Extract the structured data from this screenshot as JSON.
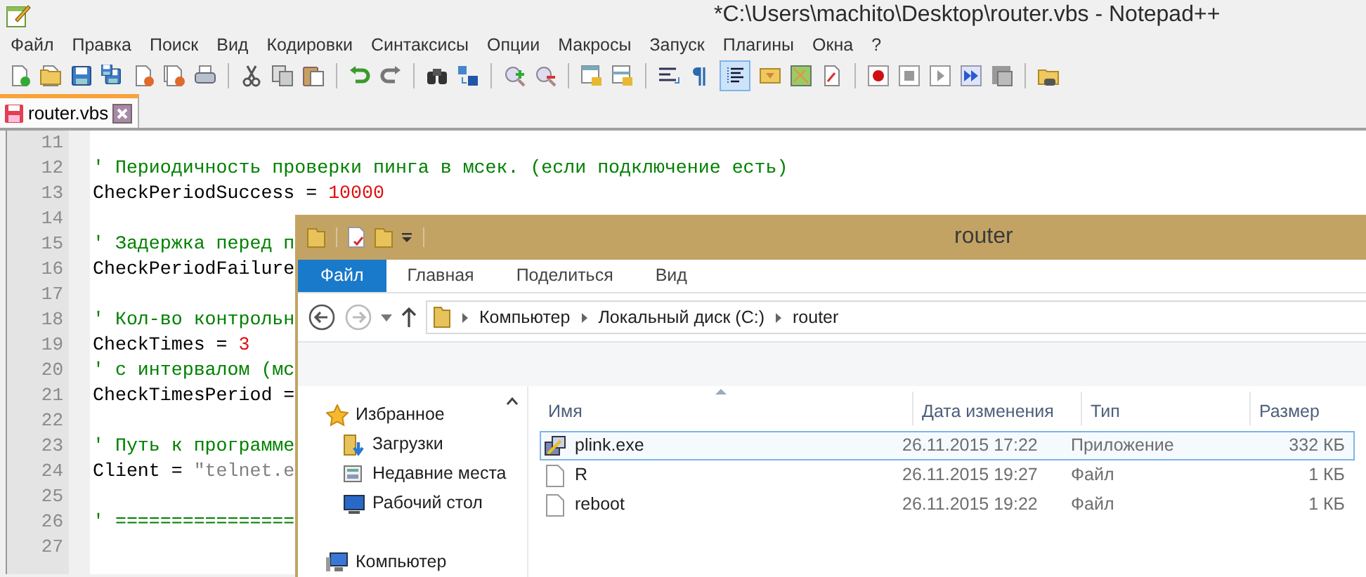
{
  "notepad": {
    "title": "*C:\\Users\\machito\\Desktop\\router.vbs - Notepad++",
    "menu": [
      "Файл",
      "Правка",
      "Поиск",
      "Вид",
      "Кодировки",
      "Синтаксисы",
      "Опции",
      "Макросы",
      "Запуск",
      "Плагины",
      "Окна",
      "?"
    ],
    "tabs": [
      {
        "label": "router.vbs",
        "selected": true,
        "modified": true
      }
    ],
    "lines": [
      {
        "number": "11"
      },
      {
        "number": "12",
        "tokens": [
          {
            "kind": "comment",
            "text": "' Периодичность проверки пинга в мсек. (если подключение есть)"
          }
        ]
      },
      {
        "number": "13",
        "tokens": [
          {
            "kind": "plain",
            "text": "CheckPeriodSuccess = "
          },
          {
            "kind": "number",
            "text": "10000"
          }
        ]
      },
      {
        "number": "14"
      },
      {
        "number": "15",
        "tokens": [
          {
            "kind": "comment",
            "text": "' Задержка перед п"
          }
        ]
      },
      {
        "number": "16",
        "tokens": [
          {
            "kind": "plain",
            "text": "CheckPeriodFailure"
          }
        ]
      },
      {
        "number": "17"
      },
      {
        "number": "18",
        "tokens": [
          {
            "kind": "comment",
            "text": "' Кол-во контрольн"
          }
        ]
      },
      {
        "number": "19",
        "tokens": [
          {
            "kind": "plain",
            "text": "CheckTimes = "
          },
          {
            "kind": "number",
            "text": "3"
          }
        ]
      },
      {
        "number": "20",
        "tokens": [
          {
            "kind": "comment",
            "text": "' с интервалом (мс"
          }
        ]
      },
      {
        "number": "21",
        "tokens": [
          {
            "kind": "plain",
            "text": "CheckTimesPeriod ="
          }
        ]
      },
      {
        "number": "22"
      },
      {
        "number": "23",
        "tokens": [
          {
            "kind": "comment",
            "text": "' Путь к программе"
          }
        ]
      },
      {
        "number": "24",
        "tokens": [
          {
            "kind": "plain",
            "text": "Client = "
          },
          {
            "kind": "string",
            "text": "\"telnet.e"
          }
        ]
      },
      {
        "number": "25"
      },
      {
        "number": "26",
        "tokens": [
          {
            "kind": "comment",
            "text": "' ================"
          }
        ]
      },
      {
        "number": "27"
      }
    ]
  },
  "explorer": {
    "title": "router",
    "ribbon_tabs": [
      {
        "label": "Файл",
        "selected": true
      },
      {
        "label": "Главная",
        "selected": false
      },
      {
        "label": "Поделиться",
        "selected": false
      },
      {
        "label": "Вид",
        "selected": false
      }
    ],
    "breadcrumb": [
      "Компьютер",
      "Локальный диск (C:)",
      "router"
    ],
    "nav": [
      {
        "label": "Избранное",
        "kind": "favorites"
      },
      {
        "label": "Загрузки",
        "kind": "downloads"
      },
      {
        "label": "Недавние места",
        "kind": "recent"
      },
      {
        "label": "Рабочий стол",
        "kind": "desktop"
      },
      {
        "label": "Компьютер",
        "kind": "computer"
      }
    ],
    "columns": [
      "Имя",
      "Дата изменения",
      "Тип",
      "Размер"
    ],
    "files": [
      {
        "name": "plink.exe",
        "kind": "app",
        "date": "26.11.2015 17:22",
        "type": "Приложение",
        "size": "332 КБ",
        "selected": true
      },
      {
        "name": "R",
        "kind": "file",
        "date": "26.11.2015 19:27",
        "type": "Файл",
        "size": "1 КБ",
        "selected": false
      },
      {
        "name": "reboot",
        "kind": "file",
        "date": "26.11.2015 19:22",
        "type": "Файл",
        "size": "1 КБ",
        "selected": false
      }
    ]
  }
}
